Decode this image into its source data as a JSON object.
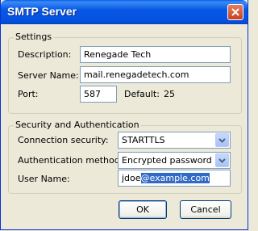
{
  "window": {
    "title": "SMTP Server"
  },
  "settings": {
    "title": "Settings",
    "description_label": "Description:",
    "description_value": "Renegade Tech",
    "server_name_label": "Server Name:",
    "server_name_value": "mail.renegadetech.com",
    "port_label": "Port:",
    "port_value": "587",
    "default_label": "Default:",
    "default_value": "25"
  },
  "security": {
    "title": "Security and Authentication",
    "connection_label": "Connection security:",
    "connection_value": "STARTTLS",
    "auth_label": "Authentication method:",
    "auth_value": "Encrypted password",
    "username_label": "User Name:",
    "username_value_plain": "jdoe",
    "username_value_selected": "@example.com"
  },
  "buttons": {
    "ok": "OK",
    "cancel": "Cancel"
  },
  "colors": {
    "title_bar": "#0554e0",
    "close_button": "#d45a36",
    "selection": "#316ac5",
    "dialog_bg": "#ece9d8"
  }
}
